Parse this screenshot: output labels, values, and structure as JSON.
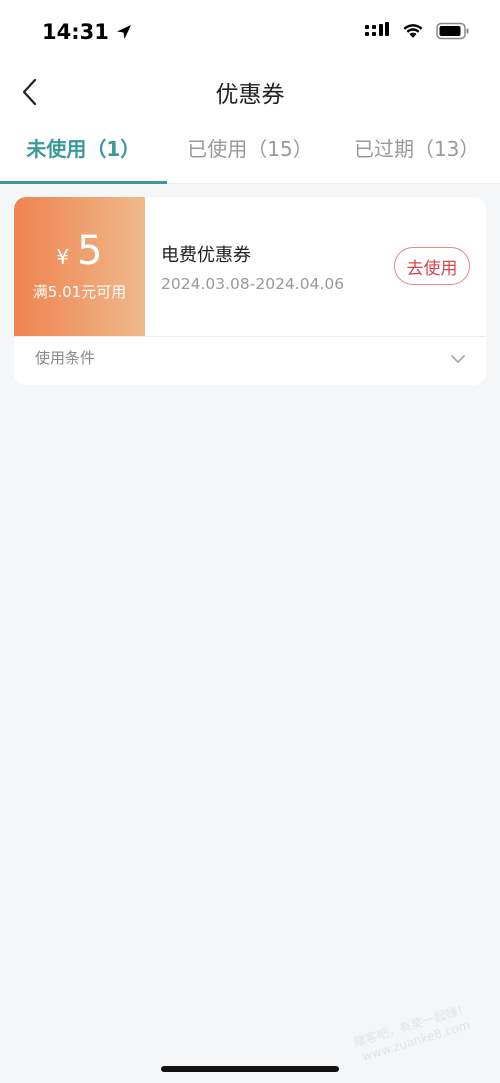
{
  "status": {
    "time": "14:31"
  },
  "nav": {
    "title": "优惠券"
  },
  "tabs": [
    {
      "label": "未使用（1）",
      "active": true
    },
    {
      "label": "已使用（15）",
      "active": false
    },
    {
      "label": "已过期（13）",
      "active": false
    }
  ],
  "coupon": {
    "currency": "¥",
    "amount": "5",
    "threshold": "满5.01元可用",
    "name": "电费优惠券",
    "date_range": "2024.03.08-2024.04.06",
    "use_label": "去使用",
    "conditions_label": "使用条件"
  },
  "watermark": {
    "line1": "赚客吧，有奖一起赚！",
    "line2": "www.zuanke8.com"
  },
  "colors": {
    "accent": "#3a9a9a",
    "coupon_start": "#ee8450",
    "coupon_end": "#f0b88a",
    "button": "#d9464e"
  }
}
